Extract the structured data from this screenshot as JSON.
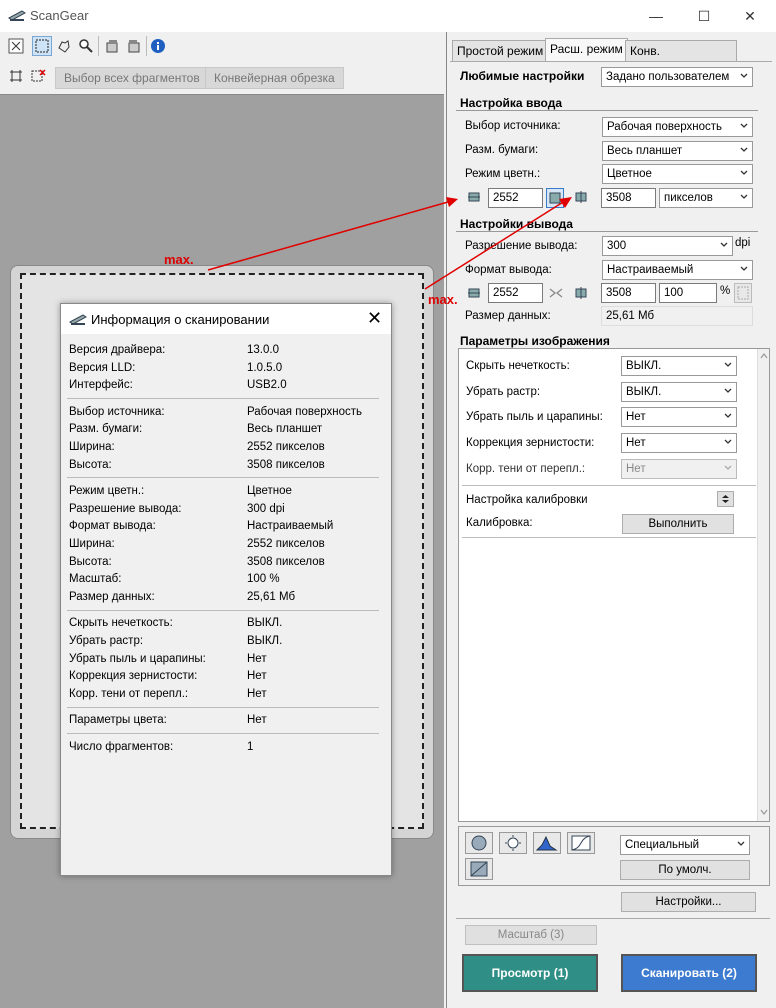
{
  "window": {
    "title": "ScanGear",
    "minimize": "—",
    "maximize": "☐",
    "close": "✕"
  },
  "toolbar2": {
    "select_all": "Выбор всех фрагментов",
    "conveyor": "Конвейерная обрезка"
  },
  "annotations": {
    "max_left": "max.",
    "max_right": "max."
  },
  "colors": {
    "accent_teal": "#2f8f86",
    "accent_blue": "#3d7bd0",
    "arrow": "#e00000"
  },
  "info_dialog": {
    "title": "Информация о сканировании",
    "groups": [
      [
        {
          "k": "Версия драйвера:",
          "v": "13.0.0"
        },
        {
          "k": "Версия LLD:",
          "v": "1.0.5.0"
        },
        {
          "k": "Интерфейс:",
          "v": "USB2.0"
        }
      ],
      [
        {
          "k": "Выбор источника:",
          "v": "Рабочая поверхность"
        },
        {
          "k": "Разм. бумаги:",
          "v": "Весь планшет"
        },
        {
          "k": "Ширина:",
          "v": "2552 пикселов"
        },
        {
          "k": "Высота:",
          "v": "3508 пикселов"
        }
      ],
      [
        {
          "k": "Режим цветн.:",
          "v": "Цветное"
        },
        {
          "k": "Разрешение вывода:",
          "v": "300 dpi"
        },
        {
          "k": "Формат вывода:",
          "v": "Настраиваемый"
        },
        {
          "k": "Ширина:",
          "v": "2552 пикселов"
        },
        {
          "k": "Высота:",
          "v": "3508 пикселов"
        },
        {
          "k": "Масштаб:",
          "v": "100 %"
        },
        {
          "k": "Размер данных:",
          "v": "25,61 Мб"
        }
      ],
      [
        {
          "k": "Скрыть нечеткость:",
          "v": "ВЫКЛ."
        },
        {
          "k": "Убрать растр:",
          "v": "ВЫКЛ."
        },
        {
          "k": "Убрать пыль и царапины:",
          "v": "Нет"
        },
        {
          "k": "Коррекция зернистости:",
          "v": "Нет"
        },
        {
          "k": "Корр. тени от перепл.:",
          "v": "Нет"
        }
      ],
      [
        {
          "k": "Параметры цвета:",
          "v": "Нет"
        }
      ],
      [
        {
          "k": "Число фрагментов:",
          "v": "1"
        }
      ]
    ]
  },
  "tabs": [
    "Простой режим",
    "Расш. режим",
    "Конв. сканирование"
  ],
  "favorites": {
    "label": "Любимые настройки",
    "value": "Задано пользователем"
  },
  "input_settings": {
    "title": "Настройка ввода",
    "source_label": "Выбор источника:",
    "source_value": "Рабочая поверхность",
    "paper_label": "Разм. бумаги:",
    "paper_value": "Весь планшет",
    "color_label": "Режим цветн.:",
    "color_value": "Цветное",
    "width": "2552",
    "height": "3508",
    "unit": "пикселов"
  },
  "output_settings": {
    "title": "Настройки вывода",
    "res_label": "Разрешение вывода:",
    "res_value": "300",
    "res_unit": "dpi",
    "format_label": "Формат вывода:",
    "format_value": "Настраиваемый",
    "width": "2552",
    "height": "3508",
    "scale": "100",
    "scale_unit": "%",
    "size_label": "Размер данных:",
    "size_value": "25,61 Мб"
  },
  "image_settings": {
    "title": "Параметры изображения",
    "unsharp_label": "Скрыть нечеткость:",
    "unsharp_value": "ВЫКЛ.",
    "descreen_label": "Убрать растр:",
    "descreen_value": "ВЫКЛ.",
    "dust_label": "Убрать пыль и царапины:",
    "dust_value": "Нет",
    "grain_label": "Коррекция зернистости:",
    "grain_value": "Нет",
    "gutter_label": "Корр. тени от перепл.:",
    "gutter_value": "Нет",
    "calib_setting_label": "Настройка калибровки",
    "calib_label": "Калибровка:",
    "calib_button": "Выполнить"
  },
  "color_tools": {
    "preset": "Специальный",
    "defaults": "По умолч."
  },
  "buttons": {
    "settings": "Настройки...",
    "zoom": "Масштаб (3)",
    "preview": "Просмотр (1)",
    "scan": "Сканировать (2)"
  }
}
